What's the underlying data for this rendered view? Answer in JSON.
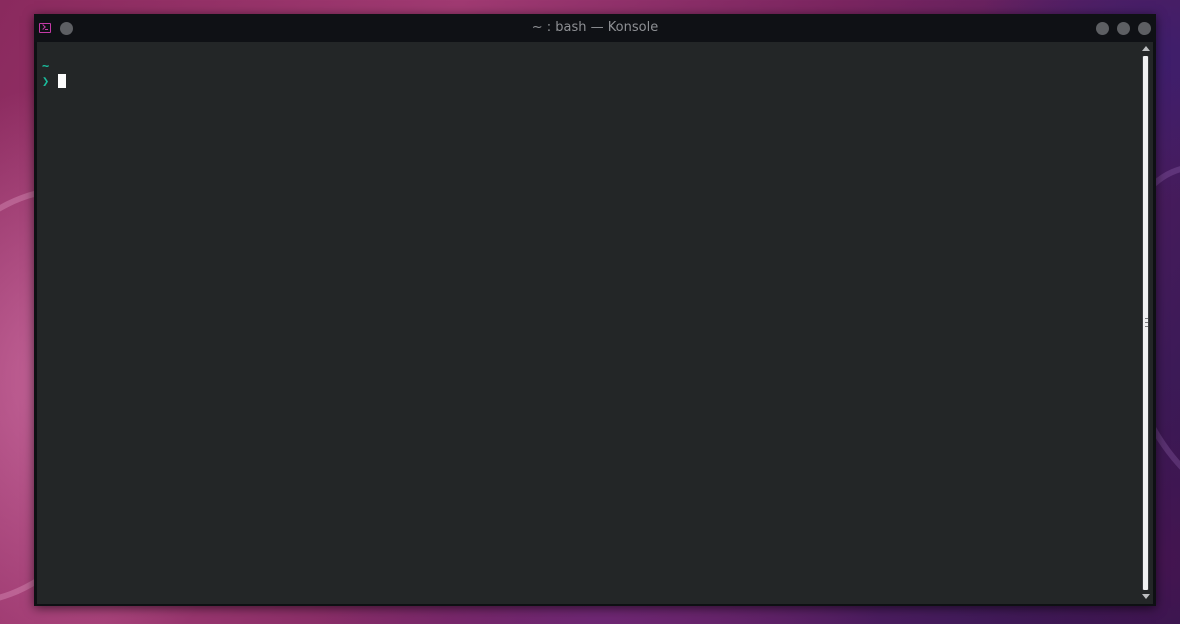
{
  "window": {
    "title": "~ : bash — Konsole"
  },
  "terminal": {
    "cwd_line": "~",
    "prompt_symbol": "❯"
  },
  "icons": {
    "app": "terminal-icon",
    "menu": "window-menu-icon",
    "minimize": "minimize-icon",
    "maximize": "maximize-icon",
    "close": "close-icon"
  },
  "colors": {
    "prompt": "#1abc9c",
    "app_icon": "#c33aa6",
    "terminal_bg": "#232627"
  }
}
